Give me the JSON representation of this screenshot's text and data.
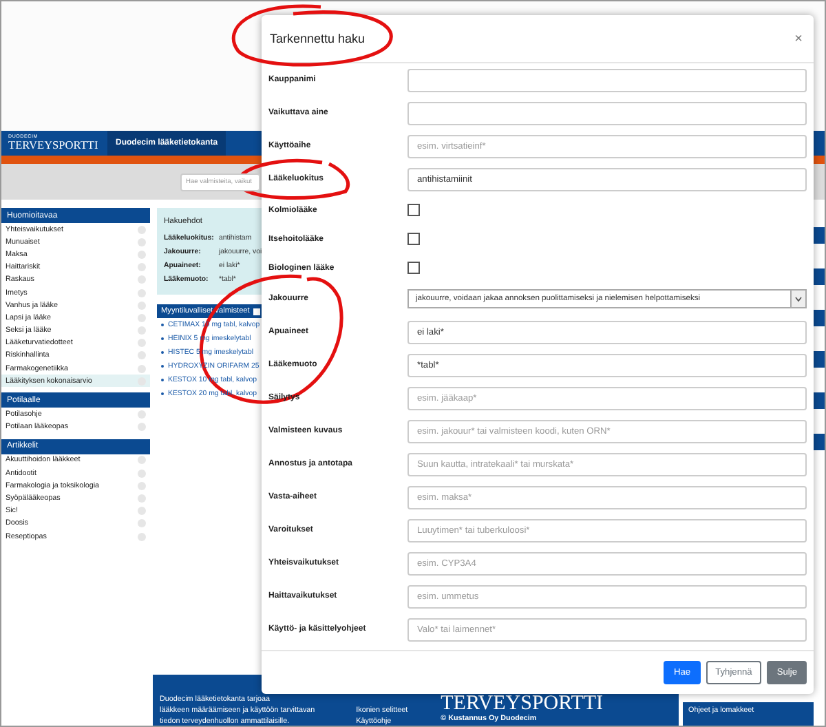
{
  "page_header": {
    "logo_small": "DUODECIM",
    "logo": "TERVEYSPORTTI",
    "tab": "Duodecim lääketietokanta"
  },
  "search": {
    "placeholder": "Hae valmisteita, vaikut"
  },
  "sidebar": [
    {
      "title": "Huomioitavaa",
      "items": [
        {
          "label": "Yhteisvaikutukset",
          "selected": false
        },
        {
          "label": "Munuaiset",
          "selected": false
        },
        {
          "label": "Maksa",
          "selected": false
        },
        {
          "label": "Haittariskit",
          "selected": false
        },
        {
          "label": "Raskaus",
          "selected": false
        },
        {
          "label": "Imetys",
          "selected": false
        },
        {
          "label": "Vanhus ja lääke",
          "selected": false
        },
        {
          "label": "Lapsi ja lääke",
          "selected": false
        },
        {
          "label": "Seksi ja lääke",
          "selected": false
        },
        {
          "label": "Lääketurvatiedotteet",
          "selected": false
        },
        {
          "label": "Riskinhallinta",
          "selected": false
        },
        {
          "label": "Farmakogenetiikka",
          "selected": false
        },
        {
          "label": "Lääkityksen kokonaisarvio",
          "selected": true
        }
      ]
    },
    {
      "title": "Potilaalle",
      "items": [
        {
          "label": "Potilasohje",
          "selected": false
        },
        {
          "label": "Potilaan lääkeopas",
          "selected": false
        }
      ]
    },
    {
      "title": "Artikkelit",
      "items": [
        {
          "label": "Akuuttihoidon lääkkeet",
          "selected": false
        },
        {
          "label": "Antidootit",
          "selected": false
        },
        {
          "label": "Farmakologia ja toksikologia",
          "selected": false
        },
        {
          "label": "Syöpälääkeopas",
          "selected": false
        },
        {
          "label": "Sic!",
          "selected": false
        },
        {
          "label": "Doosis",
          "selected": false
        },
        {
          "label": "Reseptiopas",
          "selected": false
        }
      ]
    }
  ],
  "search_criteria": {
    "title": "Hakuehdot",
    "rows": [
      {
        "label": "Lääkeluokitus:",
        "value": "antihistam"
      },
      {
        "label": "Jakouurre:",
        "value": "jakouurre, voi"
      },
      {
        "label": "Apuaineet:",
        "value": "ei laki*"
      },
      {
        "label": "Lääkemuoto:",
        "value": "*tabl*"
      }
    ]
  },
  "products": {
    "title": "Myyntiluvalliset valmisteet",
    "items": [
      "CETIMAX 10 mg tabl, kalvop",
      "HEINIX 5 mg imeskelytabl",
      "HISTEC 5 mg imeskelytabl",
      "HYDROXYZIN ORIFARM 25",
      "KESTOX 10 mg tabl, kalvop",
      "KESTOX 20 mg tabl, kalvop"
    ]
  },
  "footer": {
    "lines": [
      "Duodecim lääketietokanta tarjoaa",
      "lääkkeen määräämiseen ja käyttöön tarvittavan",
      "tiedon terveydenhuollon ammattilaisille."
    ],
    "links": [
      "Ikonien selitteet",
      "Käyttöohje"
    ],
    "brand": "TERVEYSPORTTI",
    "copyright": "© Kustannus Oy Duodecim",
    "side_title": "Ohjeet ja lomakkeet"
  },
  "dialog": {
    "title": "Tarkennettu haku",
    "close": "×",
    "fields": [
      {
        "kind": "input",
        "label": "Kauppanimi"
      },
      {
        "kind": "input",
        "label": "Vaikuttava aine"
      },
      {
        "kind": "input",
        "label": "Käyttöaihe",
        "placeholder": "esim. virtsatieinf*"
      },
      {
        "kind": "input",
        "label": "Lääkeluokitus",
        "value": "antihistamiinit"
      },
      {
        "kind": "checkbox",
        "label": "Kolmiolääke",
        "checked": false
      },
      {
        "kind": "checkbox",
        "label": "Itsehoitolääke",
        "checked": false
      },
      {
        "kind": "checkbox",
        "label": "Biologinen lääke",
        "checked": false
      },
      {
        "kind": "select",
        "label": "Jakouurre",
        "value": "jakouurre, voidaan jakaa annoksen puolittamiseksi ja nielemisen helpottamiseksi"
      },
      {
        "kind": "input",
        "label": "Apuaineet",
        "value": "ei laki*"
      },
      {
        "kind": "input",
        "label": "Lääkemuoto",
        "value": "*tabl*"
      },
      {
        "kind": "input",
        "label": "Säilytys",
        "placeholder": "esim. jääkaap*"
      },
      {
        "kind": "input",
        "label": "Valmisteen kuvaus",
        "placeholder": "esim. jakouur* tai valmisteen koodi, kuten ORN*"
      },
      {
        "kind": "input",
        "label": "Annostus ja antotapa",
        "placeholder": "Suun kautta, intratekaali* tai murskata*"
      },
      {
        "kind": "input",
        "label": "Vasta-aiheet",
        "placeholder": "esim. maksa*"
      },
      {
        "kind": "input",
        "label": "Varoitukset",
        "placeholder": "Luuytimen* tai tuberkuloosi*"
      },
      {
        "kind": "input",
        "label": "Yhteisvaikutukset",
        "placeholder": "esim. CYP3A4"
      },
      {
        "kind": "input",
        "label": "Haittavaikutukset",
        "placeholder": "esim. ummetus"
      },
      {
        "kind": "input",
        "label": "Käyttö- ja käsittelyohjeet",
        "placeholder": "Valo* tai laimennet*"
      }
    ],
    "buttons": [
      {
        "kind": "primary",
        "label": "Hae"
      },
      {
        "kind": "outline",
        "label": "Tyhjennä"
      },
      {
        "kind": "secondary",
        "label": "Sulje"
      }
    ]
  }
}
